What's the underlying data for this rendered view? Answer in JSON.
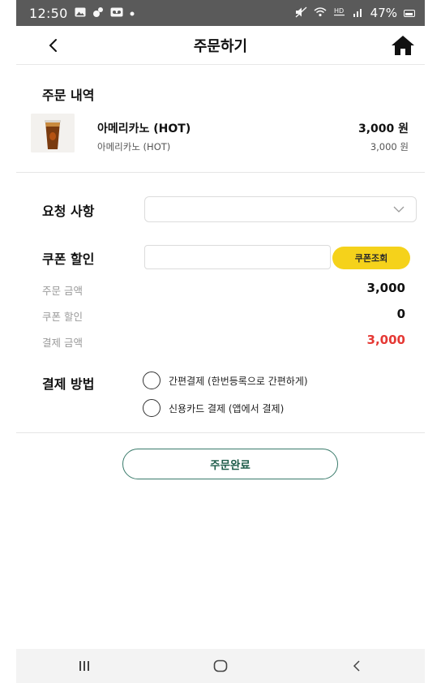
{
  "status_bar": {
    "time": "12:50",
    "battery": "47%",
    "icons_left": [
      "gallery-icon",
      "app-icon",
      "voicemail-icon",
      "dot-icon"
    ],
    "icons_right": [
      "mute-icon",
      "wifi-icon",
      "hd-icon",
      "signal-icon",
      "battery-icon"
    ]
  },
  "header": {
    "title": "주문하기",
    "back_icon": "back-arrow-icon",
    "home_icon": "home-icon"
  },
  "order": {
    "section_title": "주문 내역",
    "items": [
      {
        "name": "아메리카노 (HOT)",
        "sub_name": "아메리카노 (HOT)",
        "price": "3,000 원",
        "sub_price": "3,000 원"
      }
    ]
  },
  "request": {
    "label": "요청 사항",
    "selected": ""
  },
  "coupon": {
    "label": "쿠폰 할인",
    "value": "",
    "button_label": "쿠폰조회"
  },
  "summary": {
    "order_amount_label": "주문 금액",
    "order_amount": "3,000",
    "coupon_discount_label": "쿠폰 할인",
    "coupon_discount": "0",
    "payment_amount_label": "결제 금액",
    "payment_amount": "3,000"
  },
  "payment": {
    "label": "결제 방법",
    "options": [
      {
        "label": "간편결제 (한번등록으로 간편하게)"
      },
      {
        "label": "신용카드 결제 (앱에서 결제)"
      }
    ]
  },
  "submit": {
    "label": "주문완료"
  },
  "colors": {
    "accent_yellow": "#f5d21b",
    "total_red": "#e53935",
    "button_green": "#1e5c4a"
  }
}
